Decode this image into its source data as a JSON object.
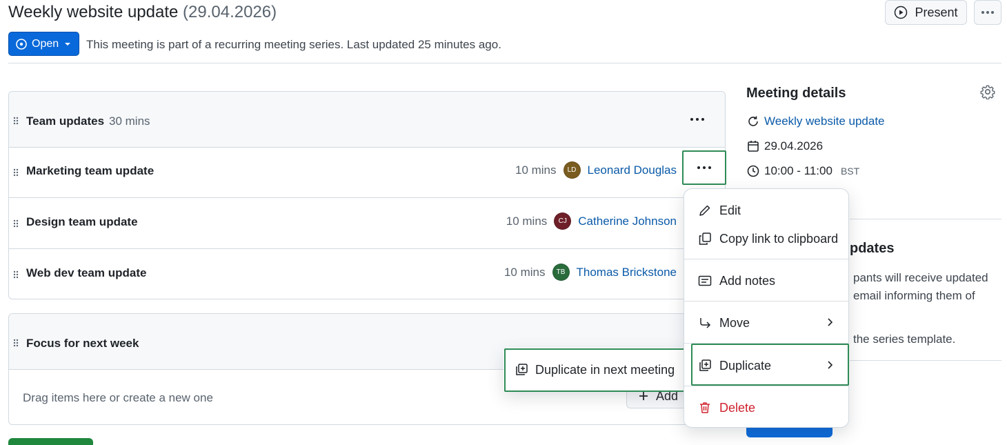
{
  "header": {
    "title": "Weekly website update",
    "title_date": "(29.04.2026)",
    "present_label": "Present",
    "state_label": "Open",
    "subtitle": "This meeting is part of a recurring meeting series. Last updated 25 minutes ago."
  },
  "agenda": {
    "sections": [
      {
        "title": "Team updates",
        "duration": "30 mins",
        "items": [
          {
            "title": "Marketing team update",
            "duration": "10 mins",
            "initials": "LD",
            "presenter": "Leonard Douglas",
            "avatar_color": "#7a5c20"
          },
          {
            "title": "Design team update",
            "duration": "10 mins",
            "initials": "CJ",
            "presenter": "Catherine Johnson",
            "avatar_color": "#6e1f28"
          },
          {
            "title": "Web dev team update",
            "duration": "10 mins",
            "initials": "TB",
            "presenter": "Thomas Brickstone",
            "avatar_color": "#2a6b3c"
          }
        ]
      },
      {
        "title": "Focus for next week",
        "drop_hint": "Drag items here or create a new one",
        "add_label": "Add"
      }
    ]
  },
  "sidebar": {
    "details_title": "Meeting details",
    "series_link": "Weekly website update",
    "date": "29.04.2026",
    "time": "10:00 - 11:00",
    "timezone": "BST",
    "updates_title_fragment": "pdates",
    "updates_text_1": "pants will receive updated",
    "updates_text_2": "email informing them of",
    "updates_text_3": "the series template."
  },
  "context_menu": {
    "edit": "Edit",
    "copy_link": "Copy link to clipboard",
    "add_notes": "Add notes",
    "move": "Move",
    "duplicate": "Duplicate",
    "delete": "Delete"
  },
  "submenu": {
    "duplicate_next": "Duplicate in next meeting"
  },
  "colors": {
    "accent": "#0969da",
    "link": "#0a5aa8",
    "danger": "#cf222e",
    "highlight": "#2e8b57"
  }
}
